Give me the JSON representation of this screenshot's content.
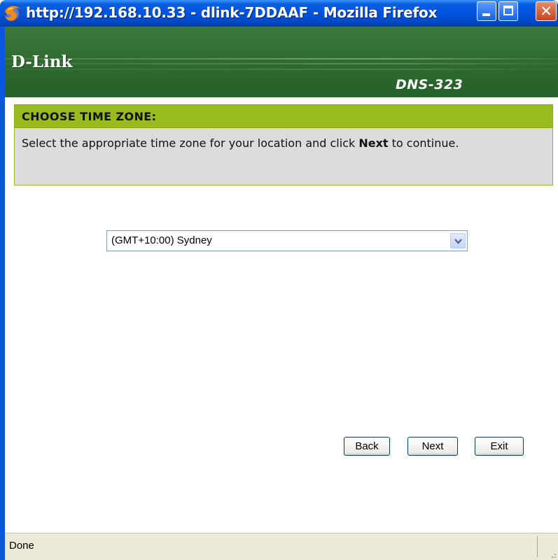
{
  "window": {
    "title": "http://192.168.10.33 - dlink-7DDAAF - Mozilla Firefox",
    "app_icon": "firefox-icon",
    "controls": [
      "minimize-icon",
      "maximize-icon",
      "close-icon"
    ]
  },
  "header": {
    "brand": "D-Link",
    "model": "DNS-323"
  },
  "section": {
    "title": "CHOOSE TIME ZONE:",
    "instruction_before": "Select the appropriate time zone for your location and click ",
    "instruction_bold": "Next",
    "instruction_after": " to continue."
  },
  "timezone_select": {
    "selected": "(GMT+10:00) Sydney"
  },
  "buttons": {
    "back": "Back",
    "next": "Next",
    "exit": "Exit"
  },
  "status": {
    "text": "Done"
  },
  "colors": {
    "section_green": "#99bb1e",
    "header_green": "#2f6a2f",
    "xp_blue": "#0055e3"
  }
}
